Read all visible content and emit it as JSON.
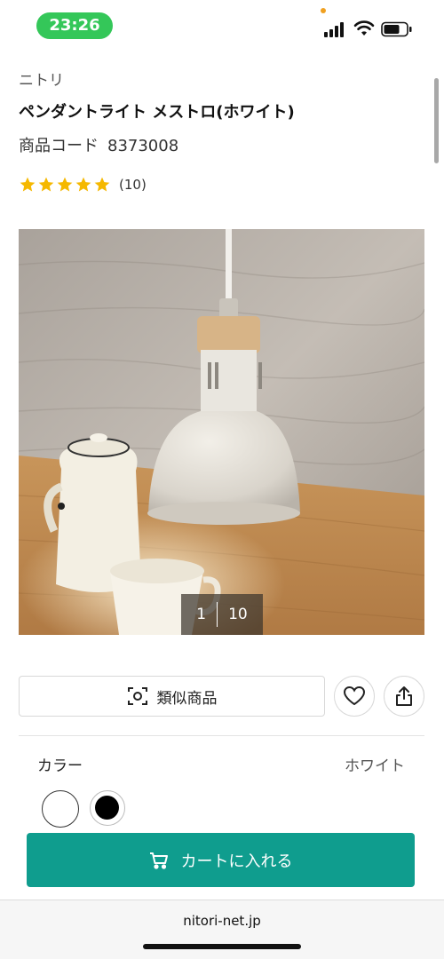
{
  "status_bar": {
    "time": "23:26"
  },
  "product": {
    "brand": "ニトリ",
    "title": "ペンダントライト メストロ(ホワイト)",
    "code_label": "商品コード",
    "code_value": "8373008",
    "rating_stars": 5,
    "review_count": "(10)"
  },
  "gallery": {
    "current": "1",
    "total": "10",
    "image_alt": "pendant-light-photo"
  },
  "actions": {
    "similar_label": "類似商品",
    "favorite_icon": "heart-icon",
    "share_icon": "share-icon"
  },
  "variant": {
    "label": "カラー",
    "selected": "ホワイト",
    "swatches": [
      "white",
      "black"
    ]
  },
  "cart": {
    "label": "カートに入れる",
    "color": "#0f9d8e"
  },
  "browser": {
    "domain": "nitori-net.jp"
  },
  "colors": {
    "accent": "#0f9d8e",
    "time_pill": "#34c759",
    "star": "#f5b800"
  }
}
